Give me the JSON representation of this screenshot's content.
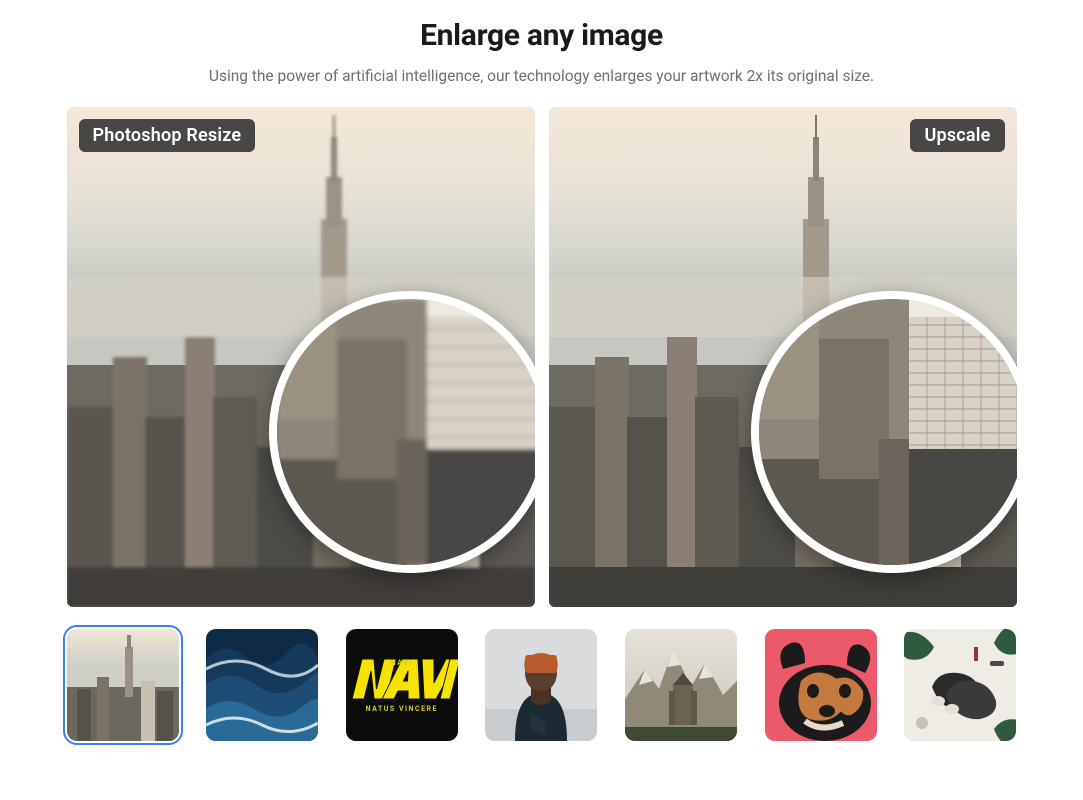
{
  "header": {
    "title": "Enlarge any image",
    "subtitle": "Using the power of artificial intelligence, our technology enlarges your artwork 2x its original size."
  },
  "comparison": {
    "left_label": "Photoshop Resize",
    "right_label": "Upscale",
    "image_subject": "city-skyline"
  },
  "thumbnails": [
    {
      "name": "city-skyline",
      "selected": true
    },
    {
      "name": "ocean-waves",
      "selected": false
    },
    {
      "name": "navi-logo",
      "selected": false,
      "logo_top": "NAVI",
      "logo_bottom": "NATUS   VINCERE"
    },
    {
      "name": "portrait-man",
      "selected": false
    },
    {
      "name": "castle-mountain",
      "selected": false
    },
    {
      "name": "dog-illustration",
      "selected": false
    },
    {
      "name": "flatlay-shoes",
      "selected": false
    }
  ]
}
